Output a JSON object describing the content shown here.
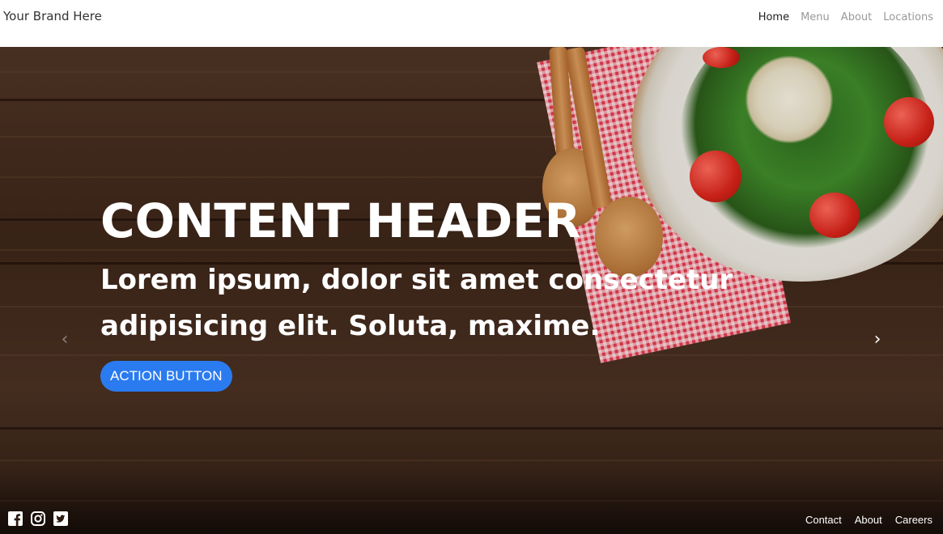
{
  "navbar": {
    "brand": "Your Brand Here",
    "links": [
      "Home",
      "Menu",
      "About",
      "Locations"
    ],
    "active": "Home"
  },
  "hero": {
    "header": "CONTENT HEADER",
    "subtext": "Lorem ipsum, dolor sit amet consectetur adipisicing elit. Soluta, maxime.",
    "action_label": "ACTION BUTTON",
    "prev_icon": "chevron-left-icon",
    "next_icon": "chevron-right-icon",
    "button_color": "#2a7bf0"
  },
  "footer": {
    "social_icons": [
      "facebook-icon",
      "instagram-icon",
      "twitter-icon"
    ],
    "links": [
      "Contact",
      "About",
      "Careers"
    ]
  }
}
